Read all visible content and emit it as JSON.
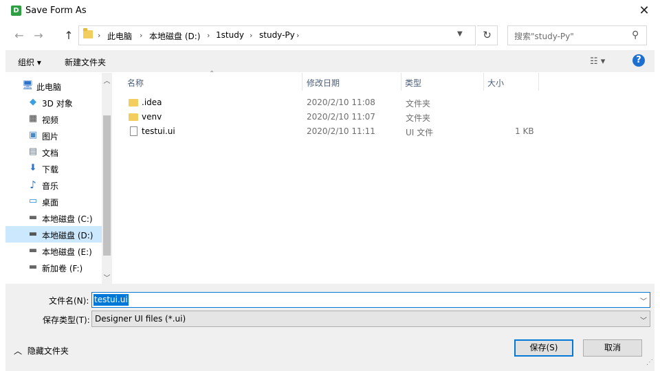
{
  "window": {
    "app_icon_letter": "D",
    "title": "Save Form As",
    "close_glyph": "✕"
  },
  "nav": {
    "back_glyph": "←",
    "forward_glyph": "→",
    "up_glyph": "↑",
    "breadcrumbs": [
      "此电脑",
      "本地磁盘 (D:)",
      "1study",
      "study-Py"
    ],
    "separator": "›",
    "refresh_glyph": "↻",
    "search_placeholder": "搜索\"study-Py\"",
    "search_glyph": "⚲"
  },
  "toolbar": {
    "organize": "组织 ▾",
    "new_folder": "新建文件夹",
    "view_glyph": "☷ ▾",
    "help_glyph": "?"
  },
  "sidebar": {
    "items": [
      {
        "label": "此电脑",
        "icon": "computer-icon",
        "glyph": "🖥"
      },
      {
        "label": "3D 对象",
        "icon": "3d-objects-icon",
        "glyph": "◆"
      },
      {
        "label": "视频",
        "icon": "videos-icon",
        "glyph": "▦"
      },
      {
        "label": "图片",
        "icon": "pictures-icon",
        "glyph": "▣"
      },
      {
        "label": "文档",
        "icon": "documents-icon",
        "glyph": "▤"
      },
      {
        "label": "下载",
        "icon": "downloads-icon",
        "glyph": "⬇"
      },
      {
        "label": "音乐",
        "icon": "music-icon",
        "glyph": "♪"
      },
      {
        "label": "桌面",
        "icon": "desktop-icon",
        "glyph": "▭"
      },
      {
        "label": "本地磁盘 (C:)",
        "icon": "drive-icon",
        "glyph": "▬"
      },
      {
        "label": "本地磁盘 (D:)",
        "icon": "drive-icon",
        "glyph": "▬"
      },
      {
        "label": "本地磁盘 (E:)",
        "icon": "drive-icon",
        "glyph": "▬"
      },
      {
        "label": "新加卷 (F:)",
        "icon": "drive-icon",
        "glyph": "▬"
      }
    ],
    "selected_index": 9
  },
  "files": {
    "columns": [
      "名称",
      "修改日期",
      "类型",
      "大小"
    ],
    "sort_glyph": "⌃",
    "rows": [
      {
        "name": ".idea",
        "date": "2020/2/10 11:08",
        "type": "文件夹",
        "size": "",
        "kind": "folder"
      },
      {
        "name": "venv",
        "date": "2020/2/10 11:07",
        "type": "文件夹",
        "size": "",
        "kind": "folder"
      },
      {
        "name": "testui.ui",
        "date": "2020/2/10 11:11",
        "type": "UI 文件",
        "size": "1 KB",
        "kind": "file"
      }
    ]
  },
  "form": {
    "filename_label": "文件名(N):",
    "filename_value": "testui.ui",
    "filetype_label": "保存类型(T):",
    "filetype_value": "Designer UI files (*.ui)",
    "hide_folders": "隐藏文件夹",
    "save": "保存(S)",
    "cancel": "取消"
  },
  "colors": {
    "accent": "#0078d7",
    "selection": "#cce8ff",
    "folder": "#f3cd5e"
  }
}
